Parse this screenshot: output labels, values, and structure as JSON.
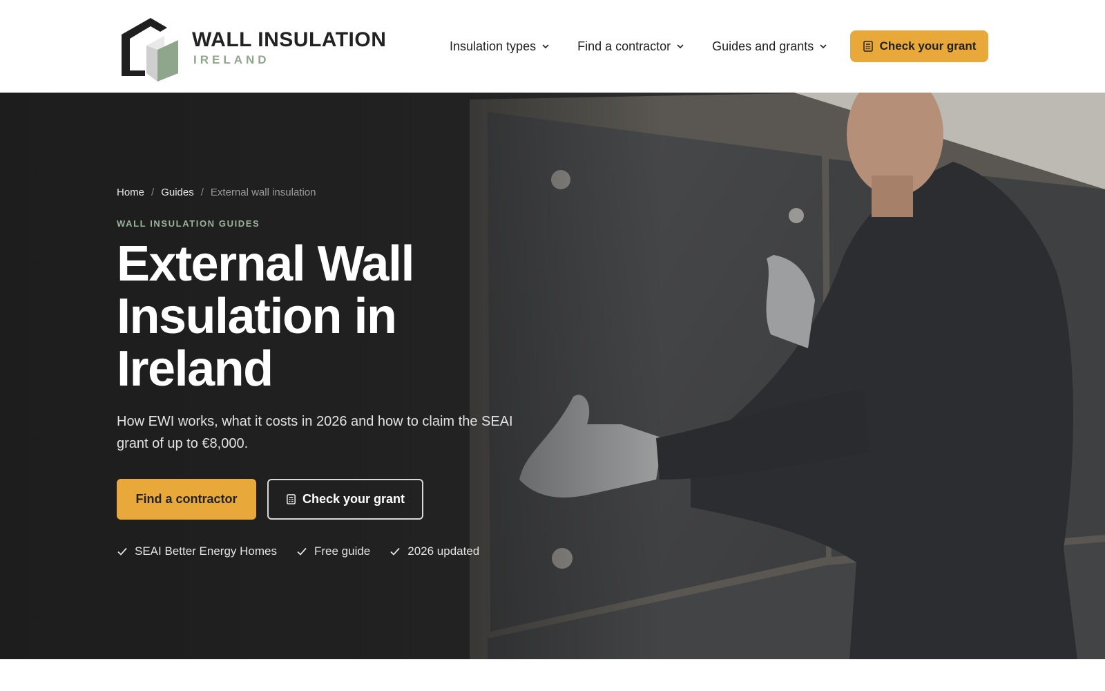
{
  "header": {
    "logo": {
      "title": "WALL INSULATION",
      "subtitle": "IRELAND"
    },
    "nav": [
      {
        "label": "Insulation types",
        "icon": "chevron-down-icon"
      },
      {
        "label": "Find a contractor",
        "icon": "chevron-down-icon"
      },
      {
        "label": "Guides and grants",
        "icon": "chevron-down-icon"
      }
    ],
    "cta": {
      "label": "Check your grant",
      "icon": "calculator-icon"
    }
  },
  "hero": {
    "breadcrumb": [
      {
        "label": "Home"
      },
      {
        "label": "Guides"
      },
      {
        "label": "External wall insulation"
      }
    ],
    "eyebrow": "WALL INSULATION GUIDES",
    "title": "External Wall Insulation in Ireland",
    "subtitle": "How EWI works, what it costs in 2026 and how to claim the SEAI grant of up to €8,000.",
    "buttons": {
      "primary": "Find a contractor",
      "secondary": "Check your grant"
    },
    "badges": [
      {
        "label": "SEAI Better Energy Homes",
        "icon": "check-icon"
      },
      {
        "label": "Free guide",
        "icon": "check-icon"
      },
      {
        "label": "2026 updated",
        "icon": "check-icon"
      }
    ],
    "image": {
      "icon": "hero-photo-worker-installing-insulation-board"
    }
  },
  "colors": {
    "accent": "#e8a93a",
    "eyebrow_green": "#9bb59a",
    "logo_green": "#8fa58c",
    "hero_dark": "#2b2b2b"
  }
}
